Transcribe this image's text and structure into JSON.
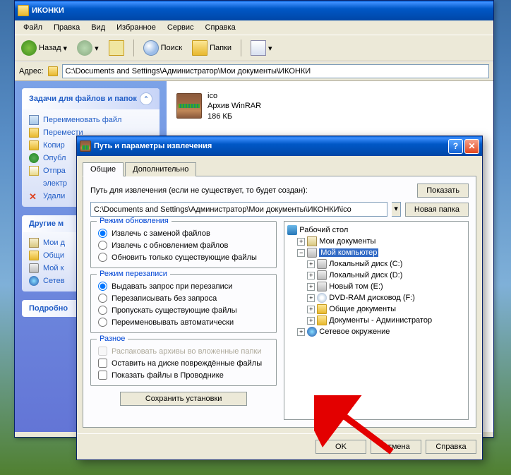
{
  "explorer": {
    "title": "ИКОНКИ",
    "menu": [
      "Файл",
      "Правка",
      "Вид",
      "Избранное",
      "Сервис",
      "Справка"
    ],
    "toolbar": {
      "back": "Назад",
      "search": "Поиск",
      "folders": "Папки"
    },
    "address_label": "Адрес:",
    "address_value": "C:\\Documents and Settings\\Администратор\\Мои документы\\ИКОНКИ",
    "tasks": {
      "title": "Задачи для файлов и папок",
      "items": [
        "Переименовать файл",
        "Перемести",
        "Копир",
        "Опубл",
        "Отпра",
        "электр",
        "Удали"
      ]
    },
    "places": {
      "title": "Другие м",
      "items": [
        "Мои д",
        "Общи",
        "Мой к",
        "Сетев"
      ]
    },
    "details": {
      "title": "Подробно"
    },
    "file": {
      "name": "ico",
      "type": "Архив WinRAR",
      "size": "186 КБ"
    }
  },
  "dialog": {
    "title": "Путь и параметры извлечения",
    "tabs": [
      "Общие",
      "Дополнительно"
    ],
    "path_label": "Путь для извлечения (если не существует, то будет создан):",
    "path_value": "C:\\Documents and Settings\\Администратор\\Мои документы\\ИКОНКИ\\ico",
    "show_btn": "Показать",
    "newfolder_btn": "Новая папка",
    "update_mode": {
      "title": "Режим обновления",
      "opts": [
        "Извлечь с заменой файлов",
        "Извлечь с обновлением файлов",
        "Обновить только существующие файлы"
      ]
    },
    "overwrite_mode": {
      "title": "Режим перезаписи",
      "opts": [
        "Выдавать запрос при перезаписи",
        "Перезаписывать без запроса",
        "Пропускать существующие файлы",
        "Переименовывать автоматически"
      ]
    },
    "misc": {
      "title": "Разное",
      "opts": [
        "Распаковать архивы во вложенные папки",
        "Оставить на диске повреждённые файлы",
        "Показать файлы в Проводнике"
      ]
    },
    "save_btn": "Сохранить установки",
    "tree": {
      "desktop": "Рабочий стол",
      "mydocs": "Мои документы",
      "mycomp": "Мой компьютер",
      "drives": [
        "Локальный диск (C:)",
        "Локальный диск (D:)",
        "Новый том (E:)",
        "DVD-RAM дисковод (F:)",
        "Общие документы",
        "Документы - Администратор"
      ],
      "network": "Сетевое окружение"
    },
    "ok": "OK",
    "cancel": "Отмена",
    "help": "Справка"
  }
}
